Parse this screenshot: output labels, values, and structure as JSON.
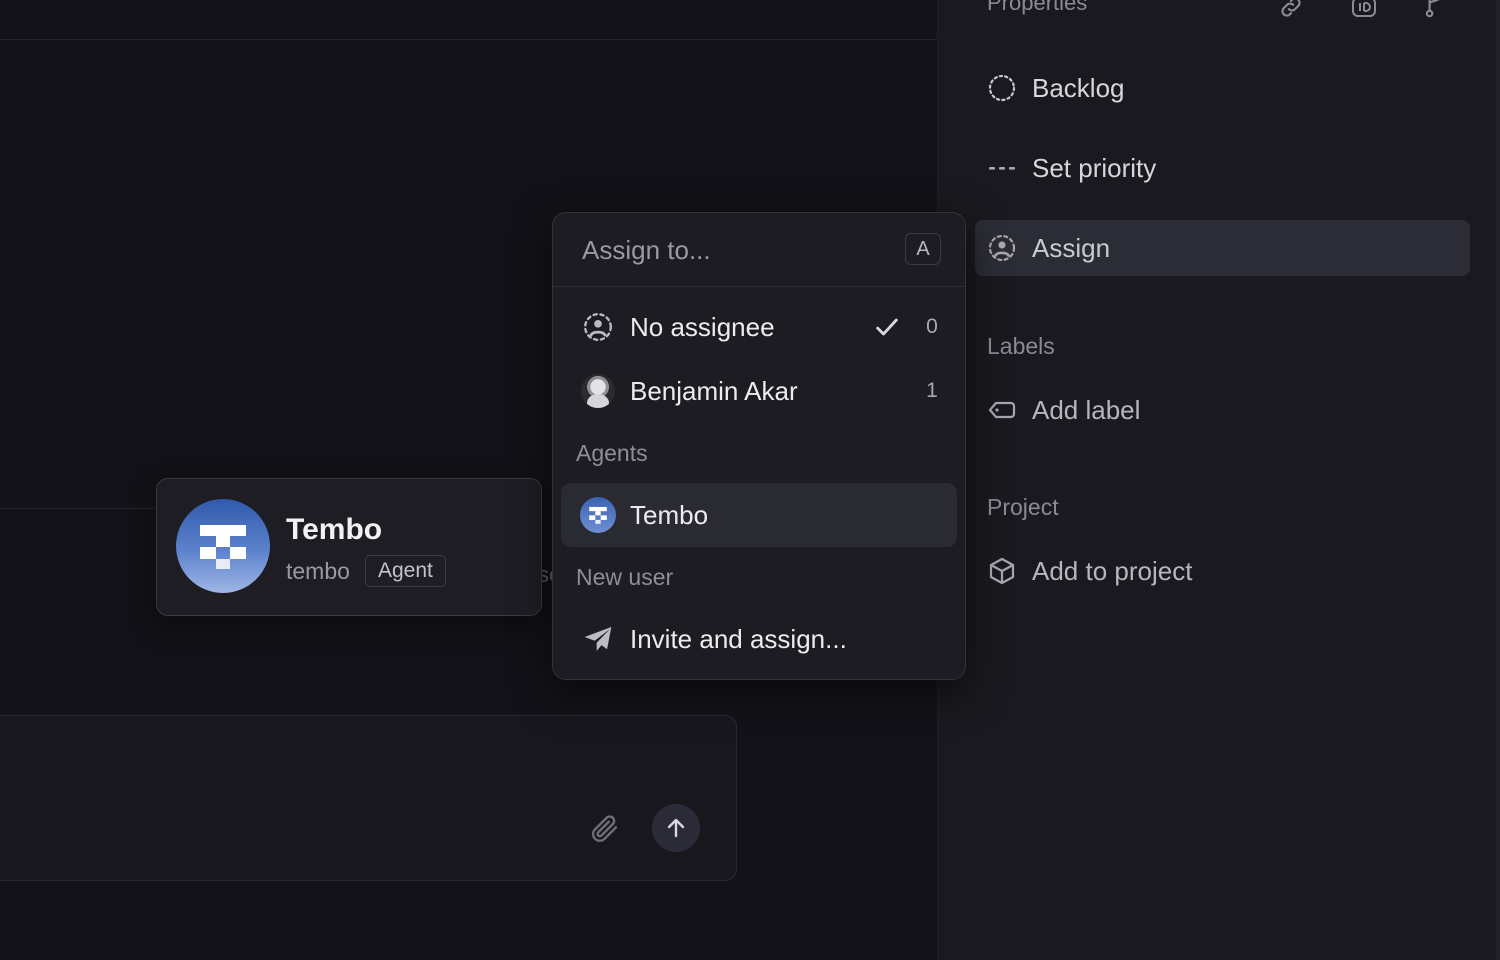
{
  "sidebar": {
    "title": "Properties",
    "status": {
      "label": "Backlog"
    },
    "priority": {
      "label": "Set priority"
    },
    "assign": {
      "label": "Assign"
    },
    "labels_section": "Labels",
    "add_label": "Add label",
    "project_section": "Project",
    "add_to_project": "Add to project"
  },
  "dropdown": {
    "placeholder": "Assign to...",
    "shortcut": "A",
    "items": [
      {
        "label": "No assignee",
        "count": "0",
        "selected": true
      },
      {
        "label": "Benjamin Akar",
        "count": "1"
      }
    ],
    "agents_group": "Agents",
    "agent": {
      "label": "Tembo"
    },
    "new_user_group": "New user",
    "invite": {
      "label": "Invite and assign..."
    }
  },
  "hovercard": {
    "name": "Tembo",
    "handle": "tembo",
    "badge": "Agent"
  },
  "main": {
    "stray_text": "sc"
  },
  "colors": {
    "background": "#131218",
    "sidebar": "#1a191f",
    "popover": "#1d1c23",
    "highlight": "#2a2a33",
    "tembo_blue": "#3a63b0"
  }
}
